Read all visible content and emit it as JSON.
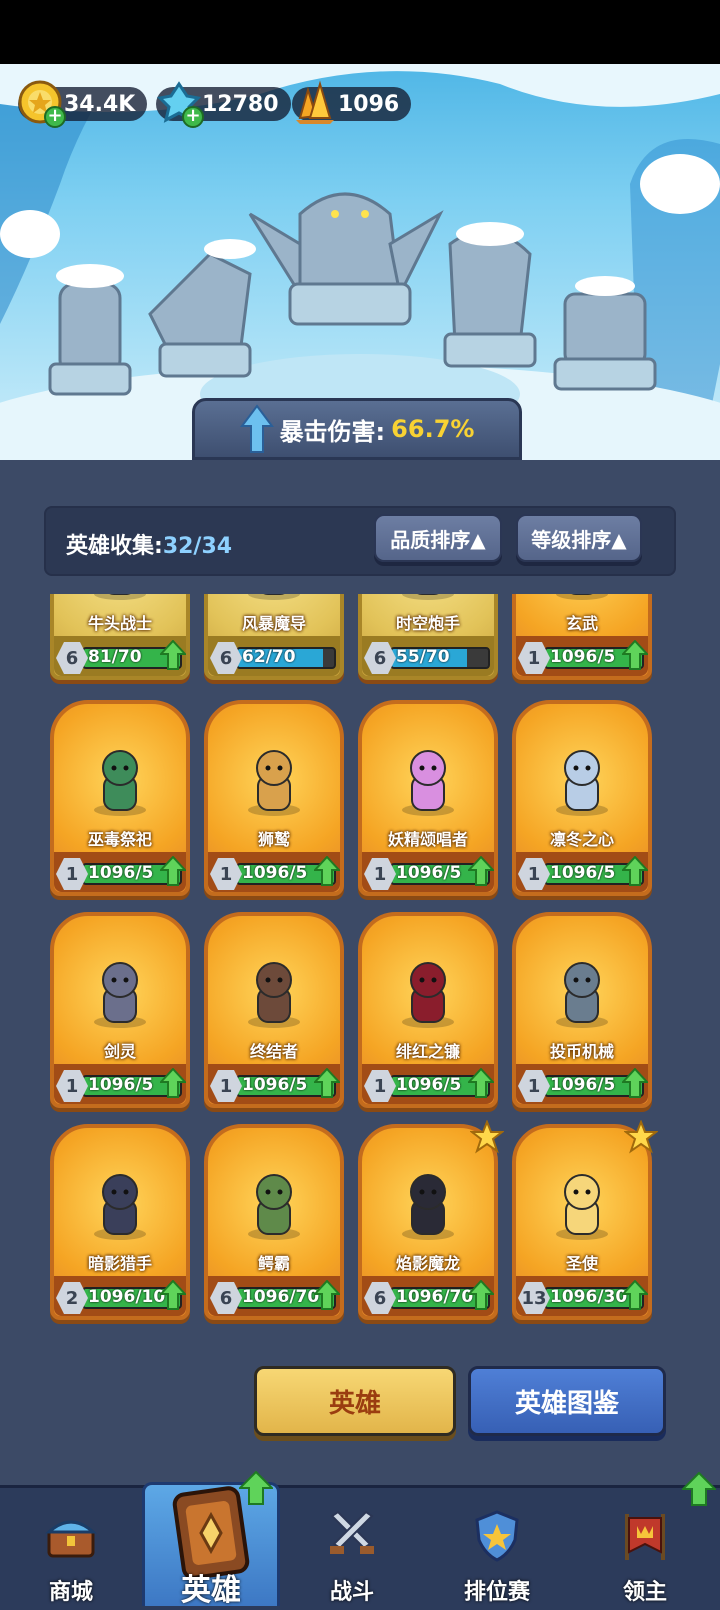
{
  "resources": {
    "gold": "34.4K",
    "diamonds": "12780",
    "crystals": "1096"
  },
  "crit": {
    "label": "暴击伤害:",
    "value": "66.7%"
  },
  "collection": {
    "label": "英雄收集:",
    "count": "32/34"
  },
  "sort": {
    "quality": "品质排序▲",
    "level": "等级排序▲"
  },
  "heroes": [
    {
      "name": "牛头战士",
      "level": "6",
      "progress": "81/70",
      "bar": "green",
      "fill": 1.0,
      "frame": "gold",
      "star": false,
      "upgrade": true
    },
    {
      "name": "风暴魔导",
      "level": "6",
      "progress": "62/70",
      "bar": "blue",
      "fill": 0.886,
      "frame": "gold",
      "star": false,
      "upgrade": false
    },
    {
      "name": "时空炮手",
      "level": "6",
      "progress": "55/70",
      "bar": "blue",
      "fill": 0.786,
      "frame": "gold",
      "star": false,
      "upgrade": false
    },
    {
      "name": "玄武",
      "level": "1",
      "progress": "1096/5",
      "bar": "green",
      "fill": 1.0,
      "frame": "orange",
      "star": false,
      "upgrade": true
    },
    {
      "name": "巫毒祭祀",
      "level": "1",
      "progress": "1096/5",
      "bar": "green",
      "fill": 1.0,
      "frame": "orange",
      "star": false,
      "upgrade": true
    },
    {
      "name": "狮鹫",
      "level": "1",
      "progress": "1096/5",
      "bar": "green",
      "fill": 1.0,
      "frame": "orange",
      "star": false,
      "upgrade": true
    },
    {
      "name": "妖精颂唱者",
      "level": "1",
      "progress": "1096/5",
      "bar": "green",
      "fill": 1.0,
      "frame": "orange",
      "star": false,
      "upgrade": true
    },
    {
      "name": "凛冬之心",
      "level": "1",
      "progress": "1096/5",
      "bar": "green",
      "fill": 1.0,
      "frame": "orange",
      "star": false,
      "upgrade": true
    },
    {
      "name": "剑灵",
      "level": "1",
      "progress": "1096/5",
      "bar": "green",
      "fill": 1.0,
      "frame": "orange",
      "star": false,
      "upgrade": true
    },
    {
      "name": "终结者",
      "level": "1",
      "progress": "1096/5",
      "bar": "green",
      "fill": 1.0,
      "frame": "orange",
      "star": false,
      "upgrade": true
    },
    {
      "name": "绯红之镰",
      "level": "1",
      "progress": "1096/5",
      "bar": "green",
      "fill": 1.0,
      "frame": "orange",
      "star": false,
      "upgrade": true
    },
    {
      "name": "投币机械",
      "level": "1",
      "progress": "1096/5",
      "bar": "green",
      "fill": 1.0,
      "frame": "orange",
      "star": false,
      "upgrade": true
    },
    {
      "name": "暗影猎手",
      "level": "2",
      "progress": "1096/10",
      "bar": "green",
      "fill": 1.0,
      "frame": "orange",
      "star": false,
      "upgrade": true
    },
    {
      "name": "鳄霸",
      "level": "6",
      "progress": "1096/70",
      "bar": "green",
      "fill": 1.0,
      "frame": "orange",
      "star": false,
      "upgrade": true
    },
    {
      "name": "焰影魔龙",
      "level": "6",
      "progress": "1096/70",
      "bar": "green",
      "fill": 1.0,
      "frame": "orange",
      "star": true,
      "upgrade": true
    },
    {
      "name": "圣使",
      "level": "13",
      "progress": "1096/30",
      "bar": "green",
      "fill": 1.0,
      "frame": "orange",
      "star": true,
      "upgrade": true
    }
  ],
  "buttons": {
    "hero": "英雄",
    "atlas": "英雄图鉴"
  },
  "nav": [
    {
      "label": "商城",
      "icon": "chest-icon",
      "active": false,
      "badge": false
    },
    {
      "label": "英雄",
      "icon": "hero-card-icon",
      "active": true,
      "badge": true
    },
    {
      "label": "战斗",
      "icon": "crossed-swords-icon",
      "active": false,
      "badge": false
    },
    {
      "label": "排位赛",
      "icon": "rank-shield-icon",
      "active": false,
      "badge": false
    },
    {
      "label": "领主",
      "icon": "lord-banner-icon",
      "active": false,
      "badge": true
    }
  ],
  "colors": {
    "accent_gold": "#f8d233",
    "panel": "#3c4a66",
    "progress_green": "#34b44a",
    "progress_blue": "#2aa7d6"
  }
}
